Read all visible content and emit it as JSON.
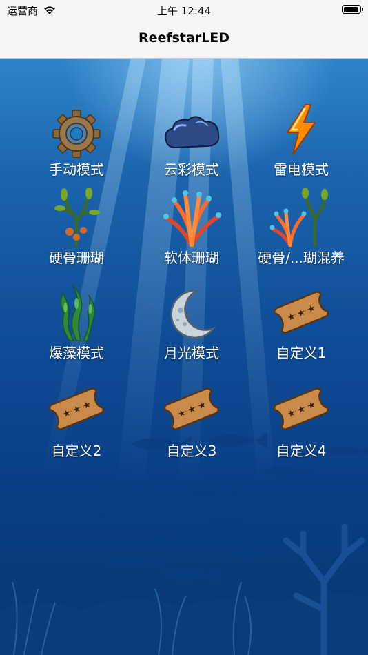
{
  "status_bar": {
    "carrier": "运营商",
    "time": "上午 12:44"
  },
  "nav": {
    "title": "ReefstarLED"
  },
  "modes": [
    {
      "label": "手动模式",
      "icon": "gear-icon"
    },
    {
      "label": "云彩模式",
      "icon": "cloud-icon"
    },
    {
      "label": "雷电模式",
      "icon": "lightning-icon"
    },
    {
      "label": "硬骨珊瑚",
      "icon": "hard-coral-icon"
    },
    {
      "label": "软体珊瑚",
      "icon": "soft-coral-icon"
    },
    {
      "label": "硬骨/...瑚混养",
      "icon": "mixed-coral-icon"
    },
    {
      "label": "爆藻模式",
      "icon": "algae-icon"
    },
    {
      "label": "月光模式",
      "icon": "moon-icon"
    },
    {
      "label": "自定义1",
      "icon": "ticket-icon"
    },
    {
      "label": "自定义2",
      "icon": "ticket-icon"
    },
    {
      "label": "自定义3",
      "icon": "ticket-icon"
    },
    {
      "label": "自定义4",
      "icon": "ticket-icon"
    }
  ]
}
